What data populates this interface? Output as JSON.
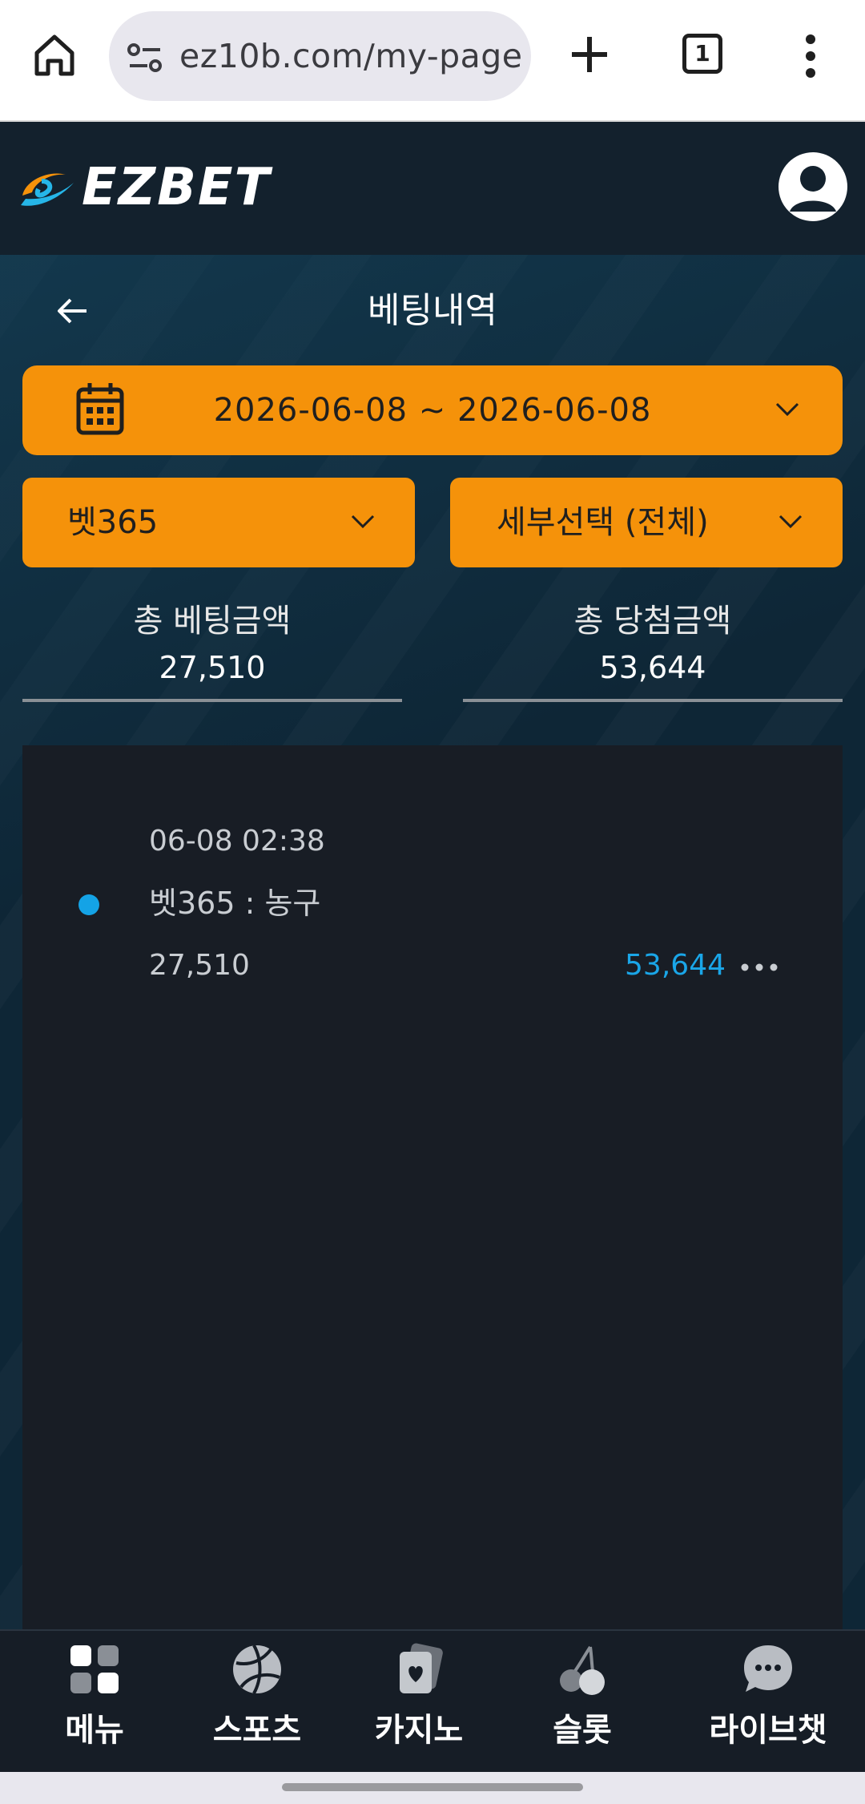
{
  "browser": {
    "url": "ez10b.com/my-page",
    "tab_count": "1"
  },
  "header": {
    "logo_text": "EZBET"
  },
  "page": {
    "title": "베팅내역"
  },
  "filters": {
    "date_range": "2026-06-08  ~  2026-06-08",
    "provider": "벳365",
    "detail": "세부선택 (전체)"
  },
  "summary": {
    "total_bet_label": "총 베팅금액",
    "total_bet_value": "27,510",
    "total_win_label": "총 당첨금액",
    "total_win_value": "53,644"
  },
  "bets": [
    {
      "time": "06-08 02:38",
      "name": "벳365 : 농구",
      "bet_amount": "27,510",
      "win_amount": "53,644"
    }
  ],
  "bottom_nav": {
    "items": [
      {
        "label": "메뉴",
        "icon": "grid-menu-icon"
      },
      {
        "label": "스포츠",
        "icon": "basketball-icon"
      },
      {
        "label": "카지노",
        "icon": "cards-icon"
      },
      {
        "label": "슬롯",
        "icon": "cherry-icon"
      },
      {
        "label": "라이브챗",
        "icon": "chat-icon"
      }
    ]
  },
  "colors": {
    "accent": "#f5920a",
    "win_text": "#1aa6e8",
    "panel": "#181d25",
    "header": "#13212d"
  }
}
